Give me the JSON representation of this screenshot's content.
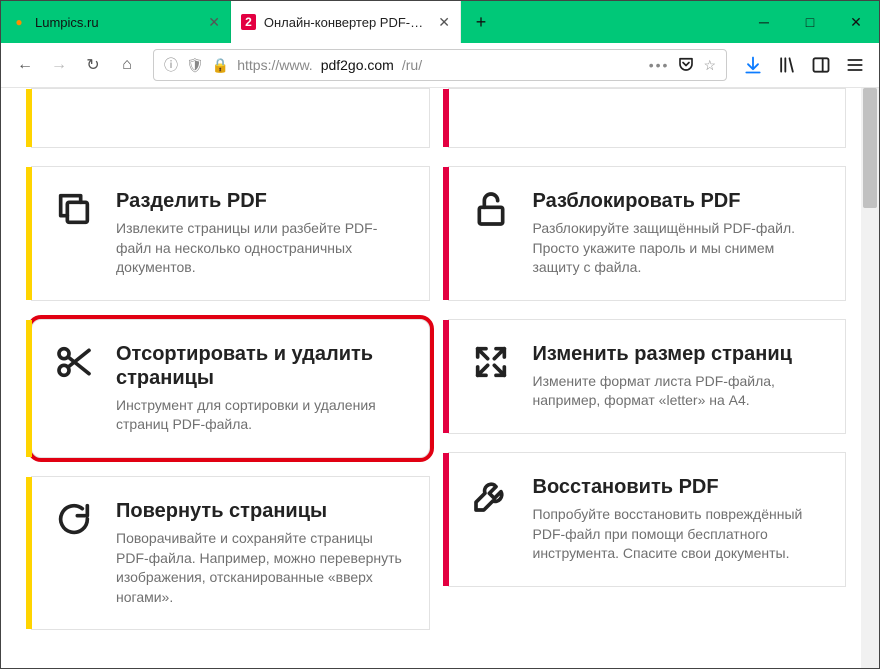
{
  "tabs": [
    {
      "title": "Lumpics.ru",
      "favicon": "●",
      "favcolor": "#ff8c00"
    },
    {
      "title": "Онлайн-конвертер PDF-файл",
      "favicon": "2",
      "favcolor": "#e30041"
    }
  ],
  "url": {
    "lock": "🔒",
    "prefix": "https://www.",
    "host": "pdf2go.com",
    "path": "/ru/"
  },
  "cards": {
    "left": [
      {
        "title": "",
        "desc": ""
      },
      {
        "title": "Разделить PDF",
        "desc": "Извлеките страницы или разбейте PDF-файл на несколько одностраничных документов."
      },
      {
        "title": "Отсортировать и удалить страницы",
        "desc": "Инструмент для сортировки и удаления страниц PDF-файла."
      },
      {
        "title": "Повернуть страницы",
        "desc": "Поворачивайте и сохраняйте страницы PDF-файла. Например, можно перевернуть изображения, отсканированные «вверх ногами»."
      }
    ],
    "right": [
      {
        "title": "",
        "desc": ""
      },
      {
        "title": "Разблокировать PDF",
        "desc": "Разблокируйте защищённый PDF-файл. Просто укажите пароль и мы снимем защиту с файла."
      },
      {
        "title": "Изменить размер страниц",
        "desc": "Измените формат листа PDF-файла, например, формат «letter» на А4."
      },
      {
        "title": "Восстановить PDF",
        "desc": "Попробуйте восстановить повреждённый PDF-файл при помощи бесплатного инструмента. Спасите свои документы."
      }
    ]
  }
}
